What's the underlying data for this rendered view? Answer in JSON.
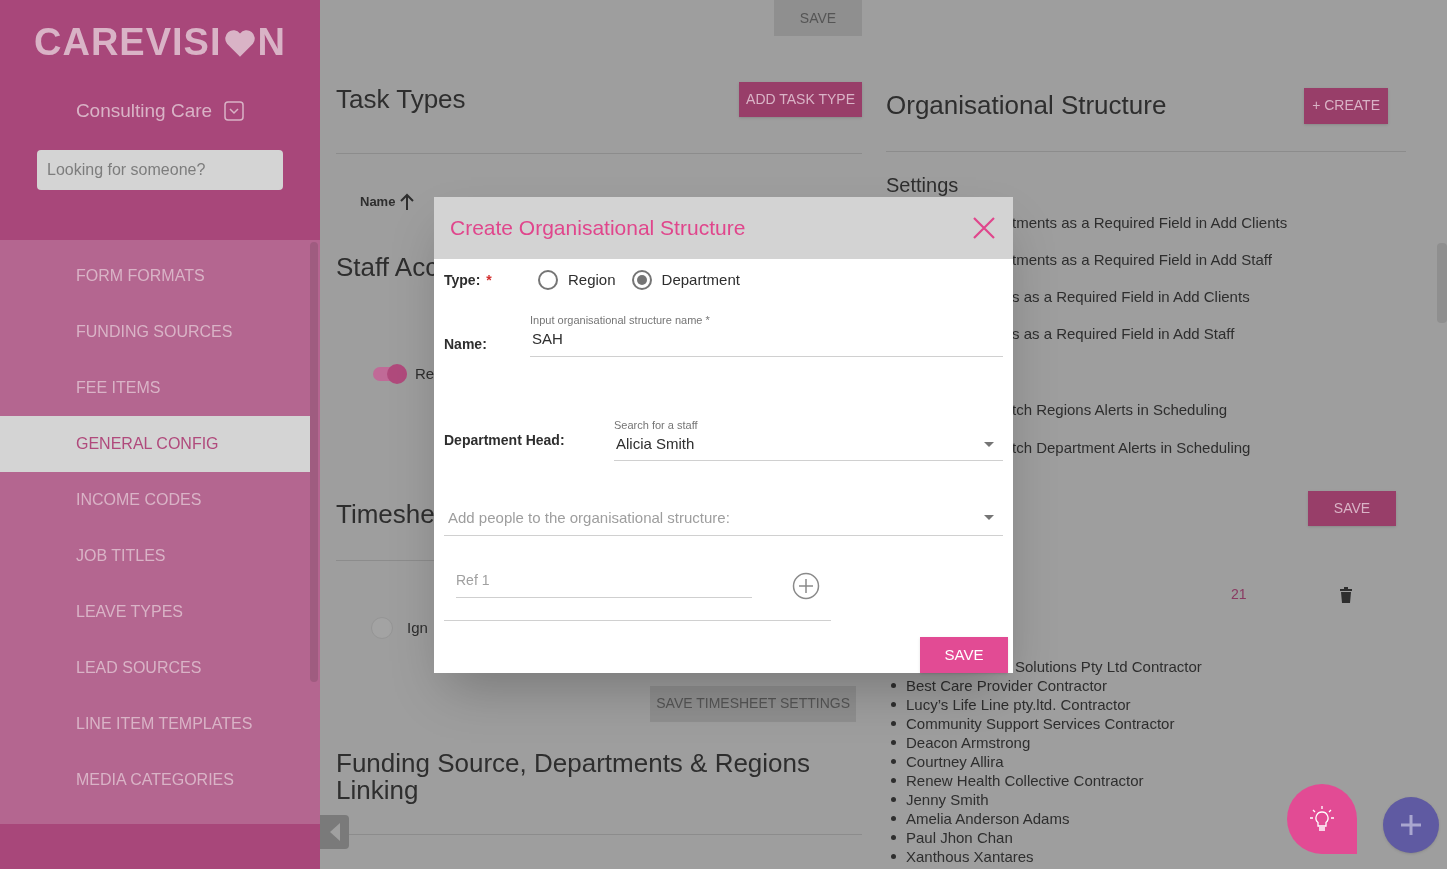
{
  "sidebar": {
    "logo": {
      "before": "CAREVISI",
      "after": "N"
    },
    "org_name": "Consulting Care",
    "search": {
      "placeholder": "Looking for someone?"
    },
    "menu": [
      {
        "label": "FORM FORMATS",
        "selected": false
      },
      {
        "label": "FUNDING SOURCES",
        "selected": false
      },
      {
        "label": "FEE ITEMS",
        "selected": false
      },
      {
        "label": "GENERAL CONFIG",
        "selected": true
      },
      {
        "label": "INCOME CODES",
        "selected": false
      },
      {
        "label": "JOB TITLES",
        "selected": false
      },
      {
        "label": "LEAVE TYPES",
        "selected": false
      },
      {
        "label": "LEAD SOURCES",
        "selected": false
      },
      {
        "label": "LINE ITEM TEMPLATES",
        "selected": false
      },
      {
        "label": "MEDIA CATEGORIES",
        "selected": false
      }
    ]
  },
  "left": {
    "top_save": {
      "label": "SAVE",
      "disabled": true
    },
    "task_types": {
      "title": "Task Types",
      "button": "ADD TASK TYPE",
      "column": "Name"
    },
    "staff_access": {
      "title": "Staff Acc",
      "toggle": {
        "on": true,
        "label": "Re"
      }
    },
    "timesheet": {
      "title": "Timeshe",
      "radio": {
        "checked": false,
        "label": "Ign"
      },
      "button": {
        "label": "SAVE TIMESHEET SETTINGS",
        "disabled": true
      }
    },
    "linking": {
      "title": "Funding Source, Departments & Regions Linking"
    }
  },
  "right": {
    "org_structure": {
      "title": "Organisational Structure",
      "button": "+ CREATE"
    },
    "settings": {
      "title": "Settings",
      "items": [
        "tments as a Required Field in Add Clients",
        "tments as a Required Field in Add Staff",
        "s as a Required Field in Add Clients",
        "s as a Required Field in Add Staff"
      ],
      "alerts": [
        "tch Regions Alerts in Scheduling",
        "tch Department Alerts in Scheduling"
      ],
      "save": "SAVE"
    },
    "row": {
      "count": "21"
    },
    "people_fragment": "Solutions Pty Ltd Contractor",
    "people": [
      "Best Care Provider Contractor",
      "Lucy’s Life Line pty.ltd. Contractor",
      "Community Support Services Contractor",
      "Deacon Armstrong",
      "Courtney Allira",
      "Renew Health Collective Contractor",
      "Jenny Smith",
      "Amelia Anderson Adams",
      "Paul Jhon Chan",
      "Xanthous Xantares"
    ]
  },
  "modal": {
    "title": "Create Organisational Structure",
    "type": {
      "label": "Type:",
      "required": "*",
      "options": [
        {
          "label": "Region",
          "selected": false
        },
        {
          "label": "Department",
          "selected": true
        }
      ]
    },
    "name": {
      "label": "Name:",
      "field_label": "Input organisational structure name *",
      "value": "SAH"
    },
    "head": {
      "label": "Department Head:",
      "field_label": "Search for a staff",
      "value": "Alicia Smith"
    },
    "people": {
      "placeholder": "Add people to the organisational structure:"
    },
    "ref": {
      "placeholder": "Ref 1"
    },
    "save": "SAVE"
  }
}
